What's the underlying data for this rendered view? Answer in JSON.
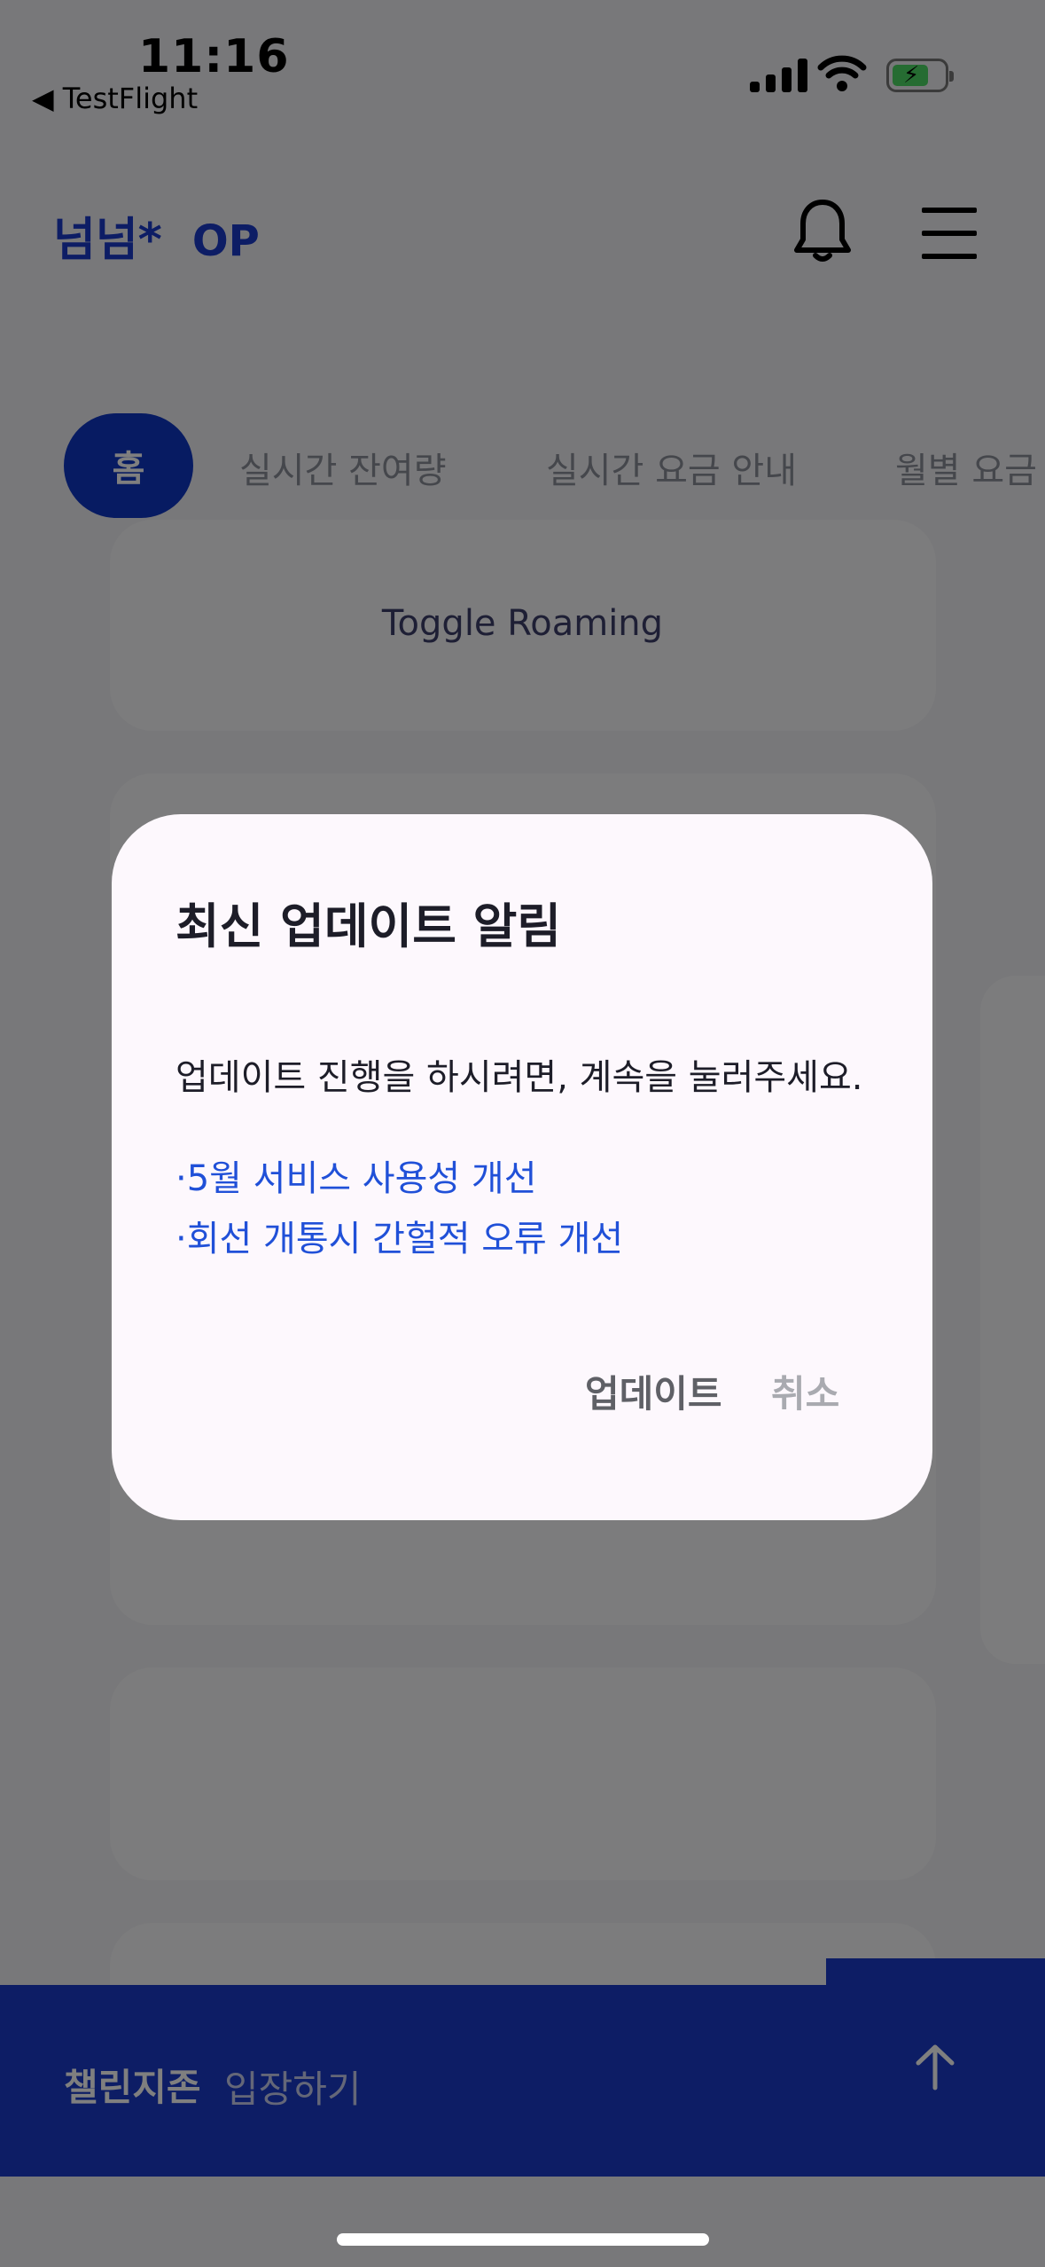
{
  "status_bar": {
    "time": "11:16",
    "back_app": "◀ TestFlight"
  },
  "header": {
    "brand": "넘넘*",
    "brand_suffix": "OP"
  },
  "tabs": [
    {
      "label": "홈",
      "active": true
    },
    {
      "label": "실시간 잔여량"
    },
    {
      "label": "실시간 요금 안내"
    },
    {
      "label": "월별 요금"
    }
  ],
  "main": {
    "toggle_roaming": "Toggle Roaming"
  },
  "bottom_bar": {
    "title": "챌린지존",
    "action": "입장하기"
  },
  "modal": {
    "title": "최신 업데이트 알림",
    "body": "업데이트 진행을 하시려면, 계속을 눌러주세요.",
    "notes": [
      "·5월 서비스 사용성 개선",
      "·회선 개통시 간헐적 오류 개선"
    ],
    "update_label": "업데이트",
    "cancel_label": "취소"
  },
  "colors": {
    "accent": "#1a3acb",
    "active_tab": "#0f36c4",
    "note": "#2050d8"
  }
}
